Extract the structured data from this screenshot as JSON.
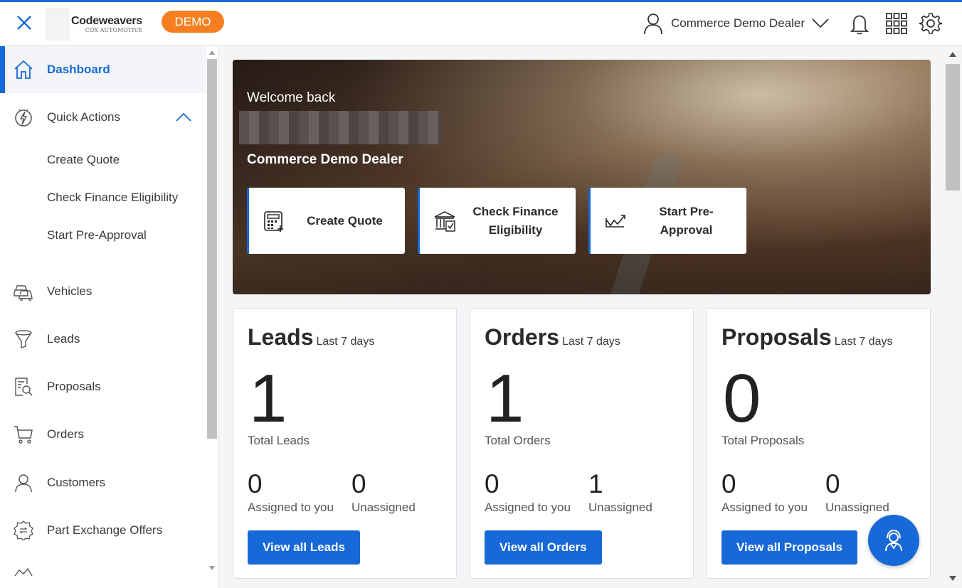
{
  "header": {
    "brand_name": "Codeweavers",
    "brand_sub": "COX AUTOMOTIVE",
    "demo_badge": "DEMO",
    "account_name": "Commerce Demo Dealer"
  },
  "sidebar": {
    "items": [
      {
        "label": "Dashboard",
        "icon": "home-icon"
      },
      {
        "label": "Quick Actions",
        "icon": "lightning-icon"
      },
      {
        "label": "Vehicles",
        "icon": "cars-icon"
      },
      {
        "label": "Leads",
        "icon": "funnel-icon"
      },
      {
        "label": "Proposals",
        "icon": "document-search-icon"
      },
      {
        "label": "Orders",
        "icon": "cart-icon"
      },
      {
        "label": "Customers",
        "icon": "users-icon"
      },
      {
        "label": "Part Exchange Offers",
        "icon": "exchange-badge-icon"
      }
    ],
    "quick_actions": [
      "Create Quote",
      "Check Finance Eligibility",
      "Start Pre-Approval"
    ]
  },
  "hero": {
    "welcome": "Welcome back",
    "dealer_name": "Commerce Demo Dealer",
    "actions": [
      "Create Quote",
      "Check Finance Eligibility",
      "Start Pre-Approval"
    ]
  },
  "cards": [
    {
      "title": "Leads",
      "period": "Last 7 days",
      "total": "1",
      "total_label": "Total Leads",
      "assigned": "0",
      "assigned_label": "Assigned to you",
      "unassigned": "0",
      "unassigned_label": "Unassigned",
      "button": "View all Leads"
    },
    {
      "title": "Orders",
      "period": "Last 7 days",
      "total": "1",
      "total_label": "Total Orders",
      "assigned": "0",
      "assigned_label": "Assigned to you",
      "unassigned": "1",
      "unassigned_label": "Unassigned",
      "button": "View all Orders"
    },
    {
      "title": "Proposals",
      "period": "Last 7 days",
      "total": "0",
      "total_label": "Total Proposals",
      "assigned": "0",
      "assigned_label": "Assigned to you",
      "unassigned": "0",
      "unassigned_label": "Unassigned",
      "button": "View all Proposals"
    }
  ],
  "colors": {
    "accent": "#1769d8",
    "demo": "#f57f20"
  }
}
